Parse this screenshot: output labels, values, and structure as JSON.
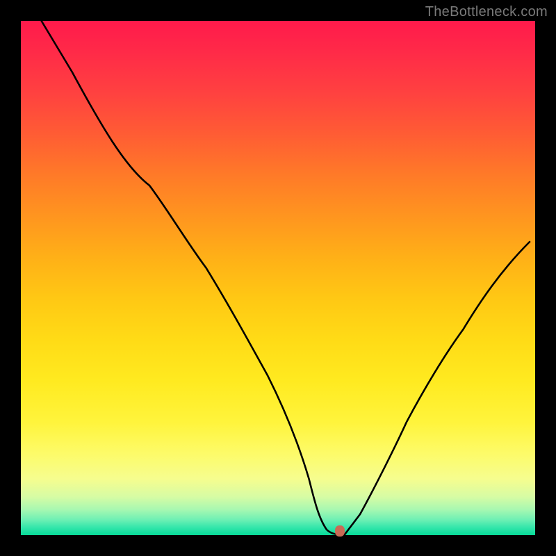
{
  "watermark": "TheBottleneck.com",
  "chart_data": {
    "type": "line",
    "title": "",
    "xlabel": "",
    "ylabel": "",
    "xlim": [
      0,
      100
    ],
    "ylim": [
      0,
      100
    ],
    "grid": false,
    "legend": false,
    "background": "rainbow-gradient-red-to-green-vertical",
    "series": [
      {
        "name": "bottleneck-curve",
        "x": [
          4,
          10,
          18,
          25,
          30,
          36,
          42,
          48,
          53,
          56,
          58,
          59.5,
          61,
          63,
          66,
          70,
          75,
          80,
          86,
          92,
          99
        ],
        "y": [
          100,
          90,
          78,
          68,
          61,
          52,
          42,
          31,
          20,
          11,
          5,
          1,
          0,
          0,
          4,
          12,
          22,
          31,
          40,
          48,
          57
        ]
      }
    ],
    "marker": {
      "x": 62,
      "y": 0.8,
      "shape": "rounded-rect",
      "color": "#c96a55"
    }
  }
}
